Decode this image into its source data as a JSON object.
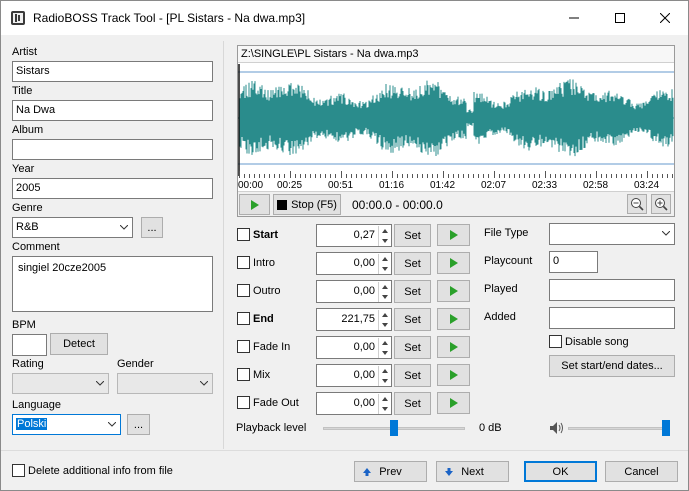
{
  "window": {
    "title": "RadioBOSS Track Tool - [PL Sistars - Na dwa.mp3]"
  },
  "colors": {
    "waveform": "#2a8c8c",
    "marker": "#6699cc",
    "accent": "#0078d7"
  },
  "left": {
    "artist": {
      "label": "Artist",
      "value": "Sistars"
    },
    "title": {
      "label": "Title",
      "value": "Na Dwa"
    },
    "album": {
      "label": "Album",
      "value": ""
    },
    "year": {
      "label": "Year",
      "value": "2005"
    },
    "genre": {
      "label": "Genre",
      "value": "R&B",
      "more": "..."
    },
    "comment": {
      "label": "Comment",
      "value": "singiel 20cze2005"
    },
    "bpm": {
      "label": "BPM",
      "value": "",
      "detect": "Detect"
    },
    "rating": {
      "label": "Rating",
      "value": ""
    },
    "gender": {
      "label": "Gender",
      "value": ""
    },
    "language": {
      "label": "Language",
      "value": "Polski",
      "more": "..."
    }
  },
  "wave": {
    "path": "Z:\\SINGLE\\PL Sistars - Na dwa.mp3",
    "ticks": [
      "00:00",
      "00:25",
      "00:51",
      "01:16",
      "01:42",
      "02:07",
      "02:33",
      "02:58",
      "03:24"
    ],
    "stop": "Stop (F5)",
    "range": "00:00.0 - 00:00.0"
  },
  "cues": [
    {
      "label": "Start",
      "bold": true,
      "value": "0,27",
      "set": "Set"
    },
    {
      "label": "Intro",
      "bold": false,
      "value": "0,00",
      "set": "Set"
    },
    {
      "label": "Outro",
      "bold": false,
      "value": "0,00",
      "set": "Set"
    },
    {
      "label": "End",
      "bold": true,
      "value": "221,75",
      "set": "Set"
    },
    {
      "label": "Fade In",
      "bold": false,
      "value": "0,00",
      "set": "Set"
    },
    {
      "label": "Mix",
      "bold": false,
      "value": "0,00",
      "set": "Set"
    },
    {
      "label": "Fade Out",
      "bold": false,
      "value": "0,00",
      "set": "Set"
    }
  ],
  "info": {
    "filetype": {
      "label": "File Type",
      "value": ""
    },
    "playcount": {
      "label": "Playcount",
      "value": "0"
    },
    "played": {
      "label": "Played",
      "value": ""
    },
    "added": {
      "label": "Added",
      "value": ""
    },
    "disable": "Disable song",
    "setdates": "Set start/end dates..."
  },
  "playback": {
    "label": "Playback level",
    "level_text": "0 dB",
    "level_fraction": 0.5,
    "volume_fraction": 1.0
  },
  "footer": {
    "delete_info": "Delete additional info from file",
    "prev": "Prev",
    "next": "Next",
    "ok": "OK",
    "cancel": "Cancel"
  }
}
